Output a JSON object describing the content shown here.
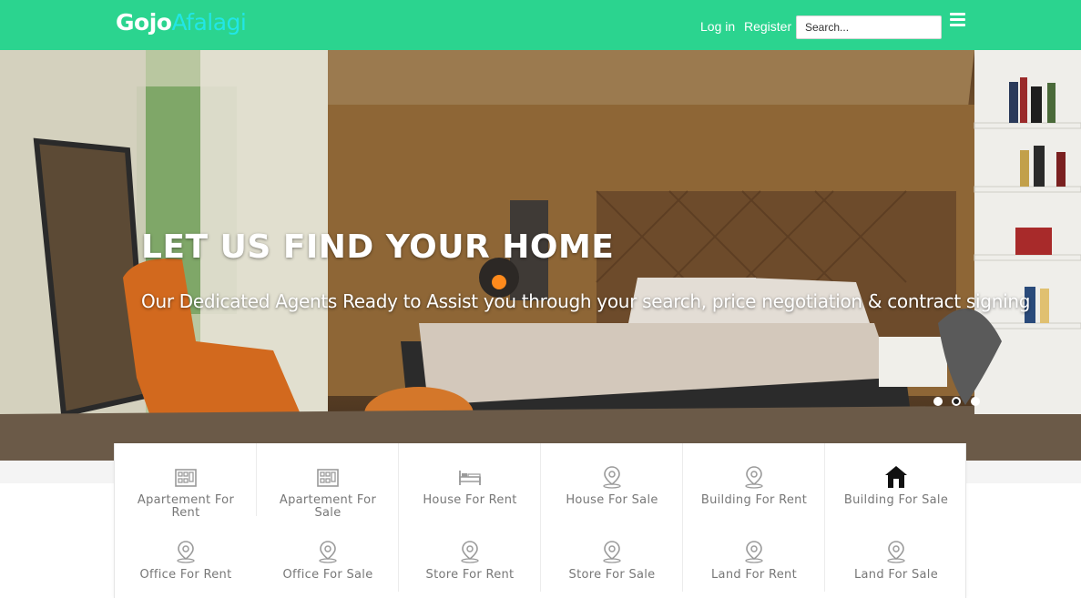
{
  "header": {
    "brand_part1": "Gojo",
    "brand_part2": "Afalagi",
    "login_label": "Log in",
    "register_label": "Register",
    "search_placeholder": "Search...",
    "menu_icon": "hamburger-menu-icon",
    "colors": {
      "bar": "#2bd48f",
      "brand_accent": "#22e6e6"
    }
  },
  "hero": {
    "title": "LET US FIND YOUR HOME",
    "subtitle": "Our Dedicated Agents Ready to Assist you through your search, price negotiation & contract signing",
    "slides": 3,
    "active_slide": 2
  },
  "categories": [
    {
      "label": "Apartement For Rent",
      "icon": "apartment-icon"
    },
    {
      "label": "Apartement For Sale",
      "icon": "apartment-icon"
    },
    {
      "label": "House For Rent",
      "icon": "bed-icon"
    },
    {
      "label": "House For Sale",
      "icon": "map-pin-icon"
    },
    {
      "label": "Building For Rent",
      "icon": "map-pin-icon"
    },
    {
      "label": "Building For Sale",
      "icon": "house-icon"
    },
    {
      "label": "Office For Rent",
      "icon": "map-pin-icon"
    },
    {
      "label": "Office For Sale",
      "icon": "map-pin-icon"
    },
    {
      "label": "Store For Rent",
      "icon": "map-pin-icon"
    },
    {
      "label": "Store For Sale",
      "icon": "map-pin-icon"
    },
    {
      "label": "Land For Rent",
      "icon": "map-pin-icon"
    },
    {
      "label": "Land For Sale",
      "icon": "map-pin-icon"
    }
  ]
}
